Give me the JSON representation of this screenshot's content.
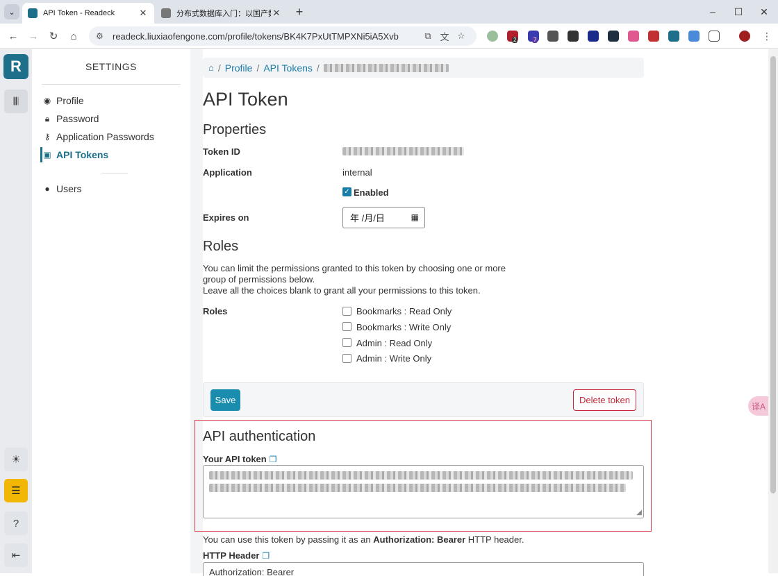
{
  "browser": {
    "tabs": [
      {
        "title": "API Token - Readeck",
        "active": true
      },
      {
        "title": "分布式数据库入门：以国产数据",
        "active": false
      }
    ],
    "url": "readeck.liuxiaofengone.com/profile/tokens/BK4K7PxUtTMPXNi5iA5Xvb",
    "new_tab": "+",
    "window_controls": [
      "–",
      "☐",
      "✕"
    ]
  },
  "rail": {
    "logo": "R",
    "extension_badges": [
      "2",
      "7"
    ]
  },
  "settings": {
    "title": "SETTINGS",
    "items": [
      {
        "label": "Profile",
        "icon": "user-circle-icon"
      },
      {
        "label": "Password",
        "icon": "lock-icon"
      },
      {
        "label": "Application Passwords",
        "icon": "key-icon"
      },
      {
        "label": "API Tokens",
        "icon": "terminal-icon",
        "active": true
      },
      {
        "label": "Users",
        "icon": "user-icon"
      }
    ]
  },
  "breadcrumb": {
    "items": [
      "Profile",
      "API Tokens"
    ]
  },
  "page": {
    "title": "API Token",
    "properties_heading": "Properties",
    "token_id_label": "Token ID",
    "application_label": "Application",
    "application_value": "internal",
    "enabled_label": "Enabled",
    "enabled": true,
    "expires_label": "Expires on",
    "expires_placeholder": "年 /月/日",
    "roles_heading": "Roles",
    "roles_help_1": "You can limit the permissions granted to this token by choosing one or more group of permissions below.",
    "roles_help_2": "Leave all the choices blank to grant all your permissions to this token.",
    "roles_label": "Roles",
    "roles": [
      {
        "label": "Bookmarks : Read Only",
        "checked": false
      },
      {
        "label": "Bookmarks : Write Only",
        "checked": false
      },
      {
        "label": "Admin : Read Only",
        "checked": false
      },
      {
        "label": "Admin : Write Only",
        "checked": false
      }
    ],
    "save_label": "Save",
    "delete_label": "Delete token",
    "auth_heading": "API authentication",
    "your_token_label": "Your API token",
    "usage_note_prefix": "You can use this token by passing it as an ",
    "usage_note_bold": "Authorization: Bearer",
    "usage_note_suffix": " HTTP header.",
    "http_header_label": "HTTP Header",
    "http_header_value": "Authorization: Bearer"
  },
  "colors": {
    "accent": "#1a7da8",
    "danger": "#c8283a",
    "highlight_box": "#d93848",
    "rail_yellow": "#f2b705"
  },
  "translate_badge": "译A"
}
